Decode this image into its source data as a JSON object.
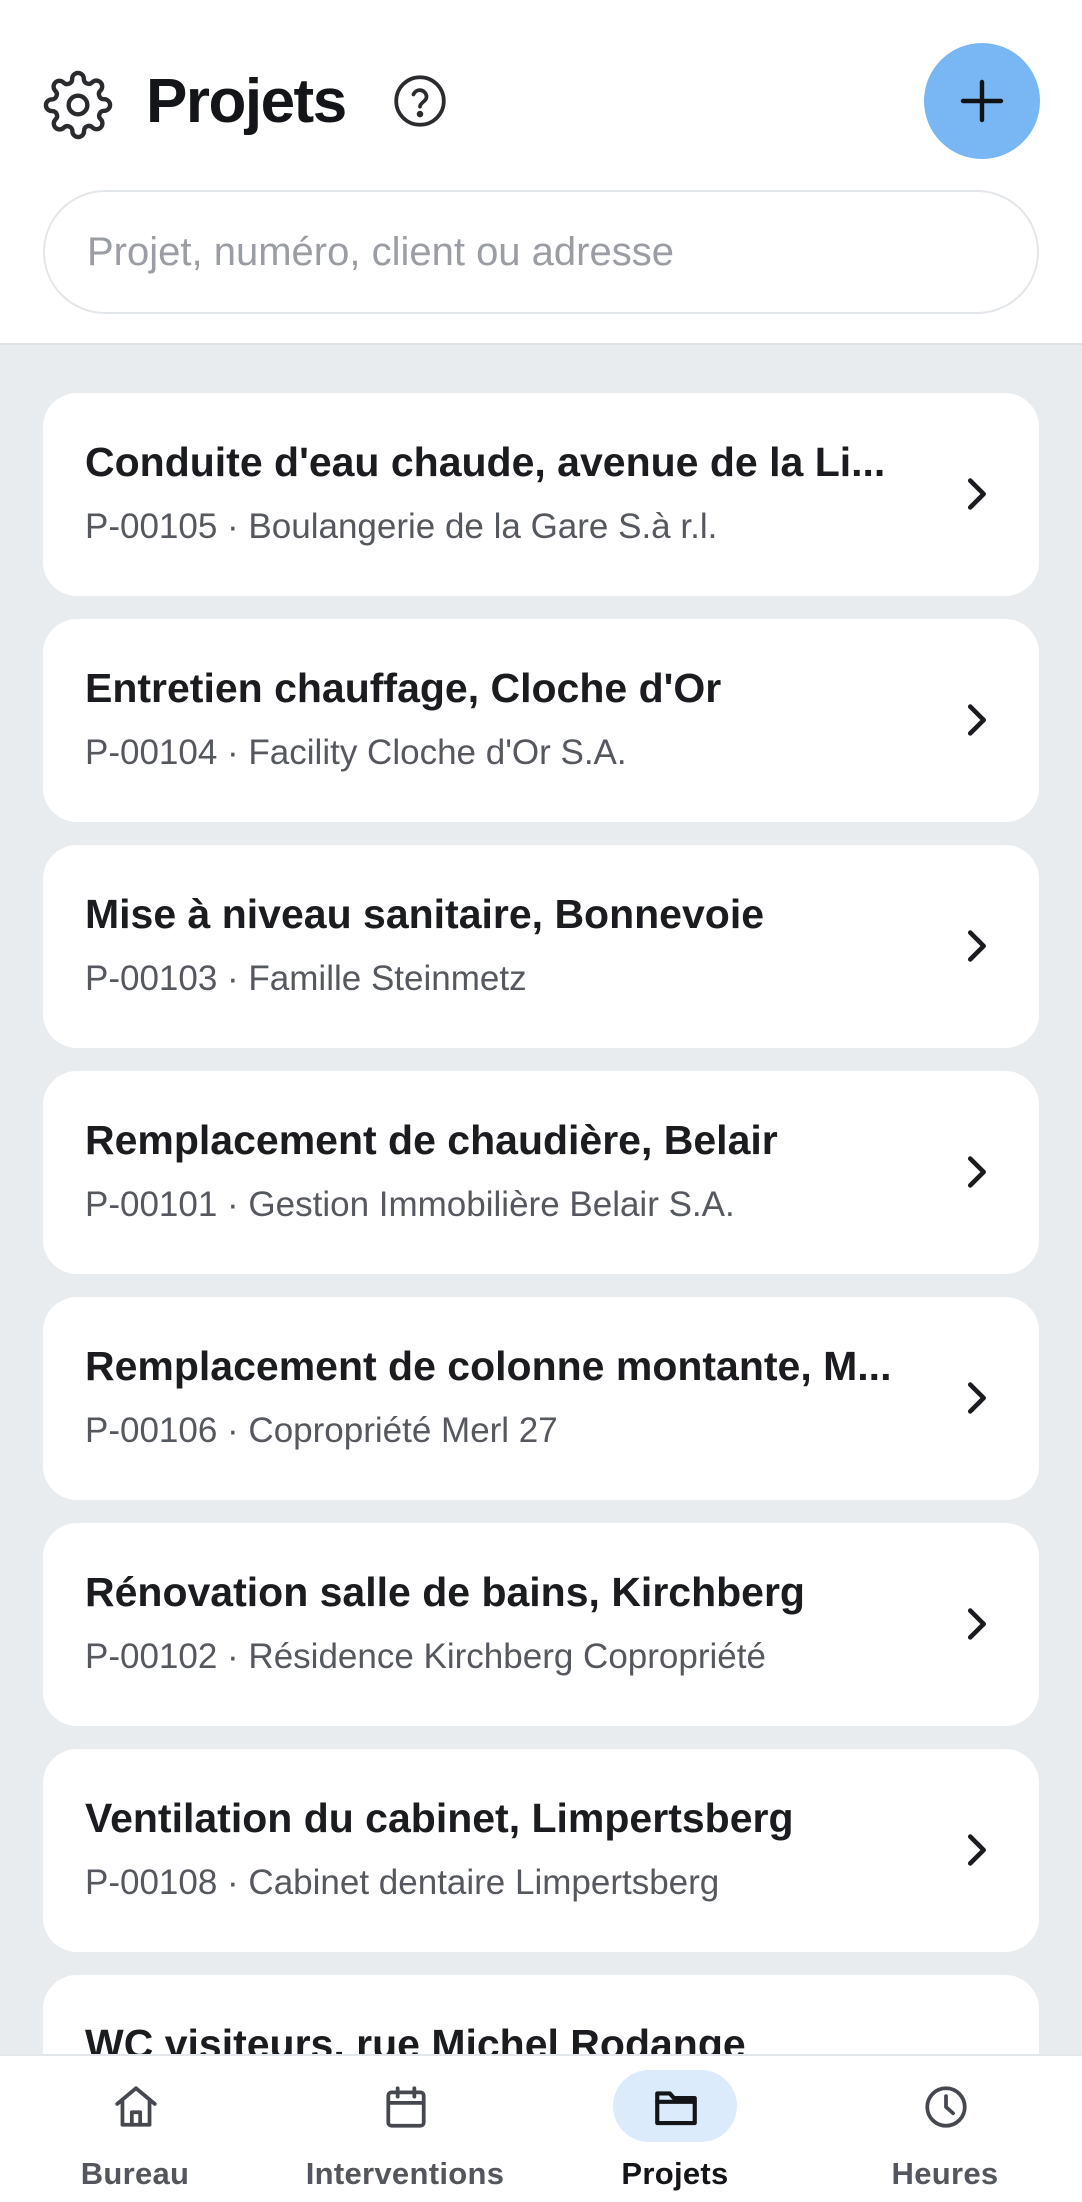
{
  "header": {
    "title": "Projets",
    "search_placeholder": "Projet, numéro, client ou adresse"
  },
  "colors": {
    "accent": "#78b6f4",
    "active_tab_bg": "#dcebfb",
    "background": "#e9ecef"
  },
  "icons": {
    "settings": "gear-icon",
    "help": "question-circle-icon",
    "add": "plus-icon",
    "row": "chevron-right-icon"
  },
  "projects": [
    {
      "title": "Conduite d'eau chaude, avenue de la Li...",
      "subtitle": "P-00105 · Boulangerie de la Gare S.à r.l."
    },
    {
      "title": "Entretien chauffage, Cloche d'Or",
      "subtitle": "P-00104 · Facility Cloche d'Or S.A."
    },
    {
      "title": "Mise à niveau sanitaire, Bonnevoie",
      "subtitle": "P-00103 · Famille Steinmetz"
    },
    {
      "title": "Remplacement de chaudière, Belair",
      "subtitle": "P-00101 · Gestion Immobilière Belair S.A."
    },
    {
      "title": "Remplacement de colonne montante, M...",
      "subtitle": "P-00106 · Copropriété Merl 27"
    },
    {
      "title": "Rénovation salle de bains, Kirchberg",
      "subtitle": "P-00102 · Résidence Kirchberg Copropriété"
    },
    {
      "title": "Ventilation du cabinet, Limpertsberg",
      "subtitle": "P-00108 · Cabinet dentaire Limpertsberg"
    },
    {
      "title": "WC visiteurs, rue Michel Rodange",
      "subtitle": ""
    }
  ],
  "tabs": [
    {
      "label": "Bureau",
      "icon": "home-icon",
      "active": false
    },
    {
      "label": "Interventions",
      "icon": "calendar-icon",
      "active": false
    },
    {
      "label": "Projets",
      "icon": "folder-icon",
      "active": true
    },
    {
      "label": "Heures",
      "icon": "clock-icon",
      "active": false
    }
  ]
}
